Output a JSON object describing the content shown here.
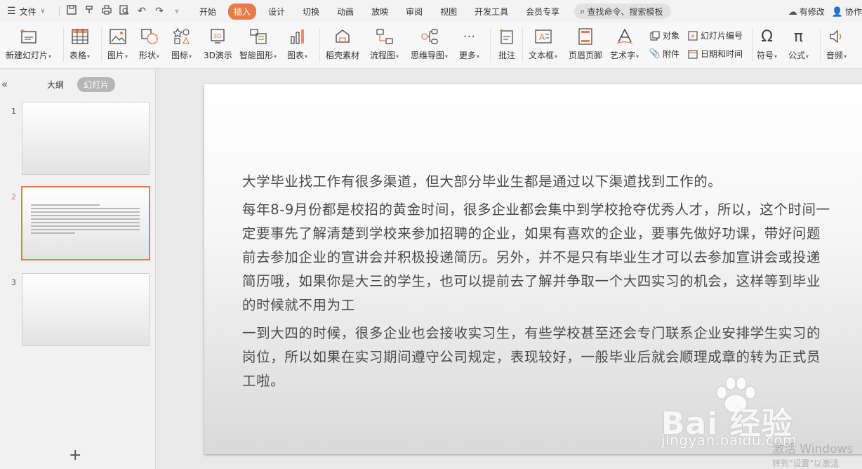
{
  "menubar": {
    "file_label": "文件",
    "tabs": [
      "开始",
      "插入",
      "设计",
      "切换",
      "动画",
      "放映",
      "审阅",
      "视图",
      "开发工具",
      "会员专享"
    ],
    "active_tab": "插入",
    "search_placeholder": "查找命令、搜索模板",
    "modified_label": "有修改",
    "collab_label": "协作"
  },
  "ribbon": {
    "new_slide": "新建幻灯片",
    "table": "表格",
    "picture": "图片",
    "shape": "形状",
    "icons": "图标",
    "3d": "3D演示",
    "smartart": "智能图形",
    "chart": "图表",
    "docer": "稻壳素材",
    "flowchart": "流程图",
    "mindmap": "思维导图",
    "more": "更多",
    "comment": "批注",
    "textbox": "文本框",
    "header_footer": "页眉页脚",
    "wordart": "艺术字",
    "object": "对象",
    "attachment": "附件",
    "slide_number": "幻灯片编号",
    "datetime": "日期和时间",
    "symbol": "符号",
    "formula": "公式",
    "audio": "音频"
  },
  "panel": {
    "outline_tab": "大纲",
    "slides_tab": "幻灯片",
    "slide_numbers": [
      "1",
      "2",
      "3"
    ],
    "add_label": "+"
  },
  "slide": {
    "paragraphs": [
      "大学毕业找工作有很多渠道，但大部分毕业生都是通过以下渠道找到工作的。",
      "每年8-9月份都是校招的黄金时间，很多企业都会集中到学校抢夺优秀人才，所以，这个时间一定要事先了解清楚到学校来参加招聘的企业，如果有喜欢的企业，要事先做好功课，带好问题前去参加企业的宣讲会并积极投递简历。另外，并不是只有毕业生才可以去参加宣讲会或投递简历哦，如果你是大三的学生，也可以提前去了解并争取一个大四实习的机会，这样等到毕业的时候就不用为工",
      "一到大四的时候，很多企业也会接收实习生，有些学校甚至还会专门联系企业安排学生实习的岗位，所以如果在实习期间遵守公司规定，表现较好，一般毕业后就会顺理成章的转为正式员工啦。"
    ]
  },
  "watermark": {
    "logo": "Bai 经验",
    "url": "jingyan.baidu.com"
  },
  "activation": {
    "line1": "激活 Windows",
    "line2": "转到\"设置\"以激活"
  },
  "colors": {
    "accent": "#e87b4b"
  }
}
